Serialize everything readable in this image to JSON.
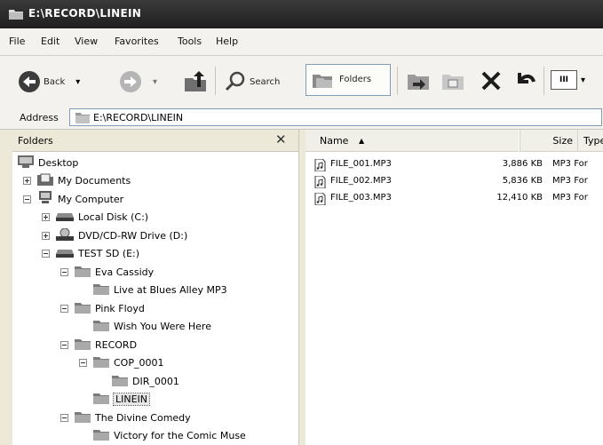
{
  "window": {
    "title": "E:\\RECORD\\LINEIN"
  },
  "menu": [
    "File",
    "Edit",
    "View",
    "Favorites",
    "Tools",
    "Help"
  ],
  "toolbar": {
    "back_label": "Back",
    "search_label": "Search",
    "folders_label": "Folders",
    "view_icon_label": "III"
  },
  "address": {
    "label": "Address",
    "path": "E:\\RECORD\\LINEIN"
  },
  "folders_pane": {
    "title": "Folders",
    "close_glyph": "✕",
    "tree": [
      {
        "label": "Desktop",
        "icon": "desktop-icon",
        "expander": "none",
        "level": 0
      },
      {
        "label": "My Documents",
        "icon": "my-documents-icon",
        "expander": "plus",
        "level": 1
      },
      {
        "label": "My Computer",
        "icon": "my-computer-icon",
        "expander": "minus",
        "level": 1
      },
      {
        "label": "Local Disk (C:)",
        "icon": "drive-icon",
        "expander": "plus",
        "level": 2
      },
      {
        "label": "DVD/CD-RW Drive (D:)",
        "icon": "dvd-drive-icon",
        "expander": "plus",
        "level": 2
      },
      {
        "label": "TEST SD (E:)",
        "icon": "drive-icon",
        "expander": "minus",
        "level": 2
      },
      {
        "label": "Eva Cassidy",
        "icon": "folder-icon",
        "expander": "minus",
        "level": 3
      },
      {
        "label": "Live at Blues Alley MP3",
        "icon": "folder-icon",
        "expander": "none",
        "level": 4
      },
      {
        "label": "Pink Floyd",
        "icon": "folder-icon",
        "expander": "minus",
        "level": 3
      },
      {
        "label": "Wish You Were Here",
        "icon": "folder-icon",
        "expander": "none",
        "level": 4
      },
      {
        "label": "RECORD",
        "icon": "folder-icon",
        "expander": "minus",
        "level": 3
      },
      {
        "label": "COP_0001",
        "icon": "folder-icon",
        "expander": "minus",
        "level": 4
      },
      {
        "label": "DIR_0001",
        "icon": "folder-icon",
        "expander": "none",
        "level": 5
      },
      {
        "label": "LINEIN",
        "icon": "folder-icon",
        "expander": "none",
        "level": 4,
        "selected": true
      },
      {
        "label": "The Divine Comedy",
        "icon": "folder-icon",
        "expander": "minus",
        "level": 3
      },
      {
        "label": "Victory for the Comic Muse",
        "icon": "folder-icon",
        "expander": "none",
        "level": 4
      }
    ]
  },
  "file_list": {
    "columns": {
      "name": "Name",
      "size": "Size",
      "type": "Type",
      "sort_glyph": "▲"
    },
    "rows": [
      {
        "name": "FILE_001.MP3",
        "size": "3,886 KB",
        "type": "MP3 For"
      },
      {
        "name": "FILE_002.MP3",
        "size": "5,836 KB",
        "type": "MP3 For"
      },
      {
        "name": "FILE_003.MP3",
        "size": "12,410 KB",
        "type": "MP3 For"
      }
    ]
  },
  "colors": {
    "titlebar": "#2a2a2a",
    "window_bg": "#ece9d8",
    "folder_yellow": "#e9c85a"
  }
}
